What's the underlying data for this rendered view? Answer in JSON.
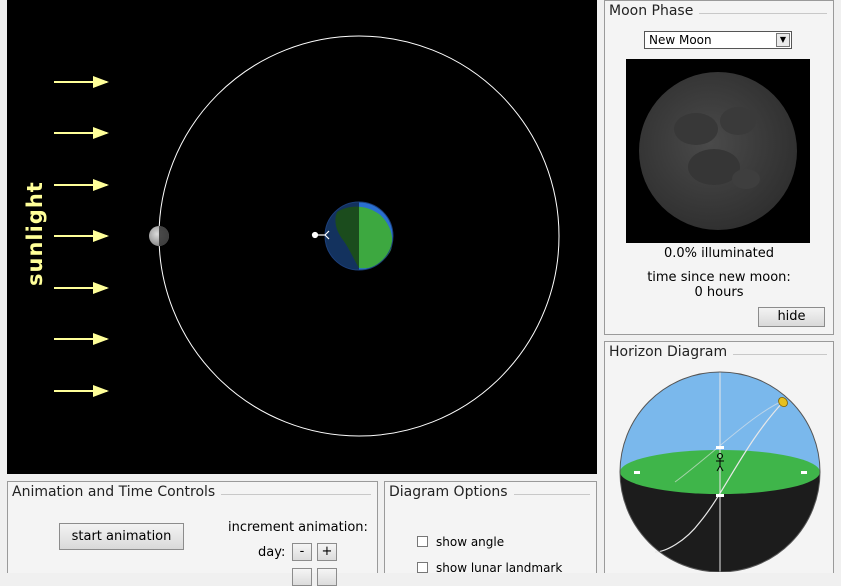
{
  "sim": {
    "sunlight_label": "sunlight"
  },
  "moon_phase": {
    "title": "Moon Phase",
    "select_value": "New Moon",
    "illuminated": "0.0% illuminated",
    "time_label": "time since new moon:",
    "time_value": "0 hours",
    "hide_button": "hide"
  },
  "horizon": {
    "title": "Horizon Diagram"
  },
  "animation": {
    "title": "Animation and Time Controls",
    "start_button": "start animation",
    "increment_label": "increment animation:",
    "day_label": "day:",
    "minus_label": "-",
    "plus_label": "+"
  },
  "options": {
    "title": "Diagram Options",
    "show_angle": "show angle",
    "show_lunar_landmark": "show lunar landmark"
  },
  "colors": {
    "sunlight": "#ffff99",
    "sky": "#6fb1ea",
    "ground": "#3fb54a"
  }
}
